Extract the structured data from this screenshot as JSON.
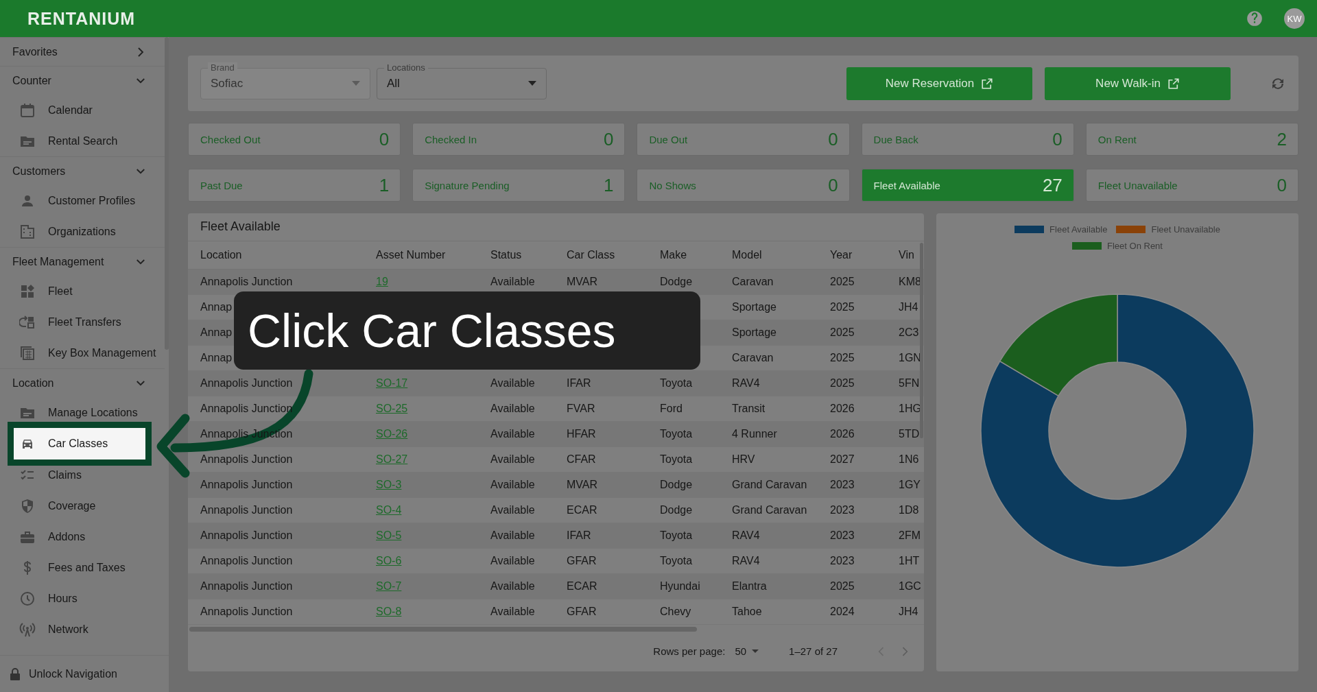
{
  "header": {
    "logo": "RENTANIUM",
    "avatar": "KW"
  },
  "sidebar": {
    "sections": [
      {
        "label": "Favorites",
        "expanded": false
      },
      {
        "label": "Counter",
        "expanded": true,
        "items": [
          {
            "label": "Calendar",
            "highlighted": false
          },
          {
            "label": "Rental Search",
            "highlighted": false
          }
        ]
      },
      {
        "label": "Customers",
        "expanded": true,
        "items": [
          {
            "label": "Customer Profiles",
            "highlighted": false
          },
          {
            "label": "Organizations",
            "highlighted": false
          }
        ]
      },
      {
        "label": "Fleet Management",
        "expanded": true,
        "items": [
          {
            "label": "Fleet",
            "highlighted": false
          },
          {
            "label": "Fleet Transfers",
            "highlighted": false
          },
          {
            "label": "Key Box Management",
            "highlighted": false
          }
        ]
      },
      {
        "label": "Location",
        "expanded": true,
        "items": [
          {
            "label": "Manage Locations",
            "highlighted": false
          },
          {
            "label": "Car Classes",
            "highlighted": true
          },
          {
            "label": "Claims",
            "highlighted": false
          },
          {
            "label": "Coverage",
            "highlighted": false
          },
          {
            "label": "Addons",
            "highlighted": false
          },
          {
            "label": "Fees and Taxes",
            "highlighted": false
          },
          {
            "label": "Hours",
            "highlighted": false
          },
          {
            "label": "Network",
            "highlighted": false
          }
        ]
      }
    ],
    "footer": "Unlock Navigation"
  },
  "filters": [
    {
      "label": "Brand",
      "value": "Sofiac",
      "disabled": true
    },
    {
      "label": "Locations",
      "value": "All",
      "disabled": false
    }
  ],
  "actions": [
    "New Reservation",
    "New Walk-in"
  ],
  "stats": [
    {
      "label": "Checked Out",
      "value": "0",
      "selected": false
    },
    {
      "label": "Checked In",
      "value": "0",
      "selected": false
    },
    {
      "label": "Due Out",
      "value": "0",
      "selected": false
    },
    {
      "label": "Due Back",
      "value": "0",
      "selected": false
    },
    {
      "label": "On Rent",
      "value": "2",
      "selected": false
    },
    {
      "label": "Past Due",
      "value": "1",
      "selected": false
    },
    {
      "label": "Signature Pending",
      "value": "1",
      "selected": false
    },
    {
      "label": "No Shows",
      "value": "0",
      "selected": false
    },
    {
      "label": "Fleet Available",
      "value": "27",
      "selected": true
    },
    {
      "label": "Fleet Unavailable",
      "value": "0",
      "selected": false
    }
  ],
  "table": {
    "title": "Fleet Available",
    "columns": [
      "Location",
      "Asset Number",
      "Status",
      "Car Class",
      "Make",
      "Model",
      "Year",
      "Vin"
    ],
    "rows": [
      [
        "Annapolis Junction",
        "19",
        "Available",
        "MVAR",
        "Dodge",
        "Caravan",
        "2025",
        "KM8"
      ],
      [
        "Annap",
        null,
        null,
        null,
        null,
        "Sportage",
        "2025",
        "JH4"
      ],
      [
        "Annap",
        null,
        null,
        null,
        null,
        "Sportage",
        "2025",
        "2C3"
      ],
      [
        "Annap",
        null,
        null,
        null,
        null,
        "Caravan",
        "2025",
        "1GN"
      ],
      [
        "Annapolis Junction",
        "SO-17",
        "Available",
        "IFAR",
        "Toyota",
        "RAV4",
        "2025",
        "5FN"
      ],
      [
        "Annapolis Junction",
        "SO-25",
        "Available",
        "FVAR",
        "Ford",
        "Transit",
        "2026",
        "1HG"
      ],
      [
        "Annapolis Junction",
        "SO-26",
        "Available",
        "HFAR",
        "Toyota",
        "4 Runner",
        "2026",
        "5TD"
      ],
      [
        "Annapolis Junction",
        "SO-27",
        "Available",
        "CFAR",
        "Toyota",
        "HRV",
        "2027",
        "1N6"
      ],
      [
        "Annapolis Junction",
        "SO-3",
        "Available",
        "MVAR",
        "Dodge",
        "Grand Caravan",
        "2023",
        "1GY"
      ],
      [
        "Annapolis Junction",
        "SO-4",
        "Available",
        "ECAR",
        "Dodge",
        "Grand Caravan",
        "2023",
        "1D8"
      ],
      [
        "Annapolis Junction",
        "SO-5",
        "Available",
        "IFAR",
        "Toyota",
        "RAV4",
        "2023",
        "2FM"
      ],
      [
        "Annapolis Junction",
        "SO-6",
        "Available",
        "GFAR",
        "Toyota",
        "RAV4",
        "2023",
        "1HT"
      ],
      [
        "Annapolis Junction",
        "SO-7",
        "Available",
        "ECAR",
        "Hyundai",
        "Elantra",
        "2025",
        "1GC"
      ],
      [
        "Annapolis Junction",
        "SO-8",
        "Available",
        "GFAR",
        "Chevy",
        "Tahoe",
        "2024",
        "JH4"
      ]
    ],
    "pagination": {
      "rows_label": "Rows per page:",
      "rows_value": "50",
      "range": "1–27 of 27"
    }
  },
  "chart": {
    "legend": [
      {
        "label": "Fleet Available",
        "color": "#0c3b5e"
      },
      {
        "label": "Fleet Unavailable",
        "color": "#8a4208"
      },
      {
        "label": "Fleet On Rent",
        "color": "#1b5e1e"
      }
    ]
  },
  "callout": "Click Car Classes"
}
